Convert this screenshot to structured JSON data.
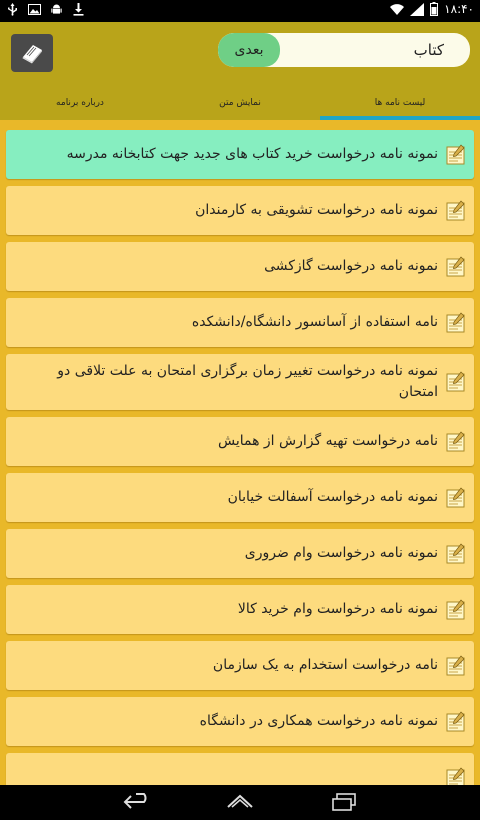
{
  "status_bar": {
    "time": "۱۸:۴۰"
  },
  "header": {
    "search": {
      "value": "کتاب"
    },
    "next_button": "بعدی",
    "book_icon": "book-icon"
  },
  "tabs": [
    {
      "label": "لیست نامه ها",
      "active": true
    },
    {
      "label": "نمایش متن",
      "active": false
    },
    {
      "label": "درباره برنامه",
      "active": false
    }
  ],
  "letters": [
    {
      "title": "نمونه نامه درخواست خرید کتاب های جدید جهت کتابخانه مدرسه",
      "selected": true
    },
    {
      "title": "نمونه نامه درخواست تشویقی به کارمندان"
    },
    {
      "title": "نمونه نامه درخواست گازکشی"
    },
    {
      "title": "نامه استفاده از آسانسور دانشگاه/دانشکده"
    },
    {
      "title": "نمونه نامه درخواست تغییر زمان برگزاری امتحان به علت تلاقی دو امتحان"
    },
    {
      "title": "نامه درخواست تهیه گزارش از همایش"
    },
    {
      "title": "نمونه نامه درخواست آسفالت خیابان"
    },
    {
      "title": "نمونه نامه درخواست وام ضروری"
    },
    {
      "title": "نمونه نامه درخواست وام خرید کالا"
    },
    {
      "title": "نامه درخواست استخدام به یک سازمان"
    },
    {
      "title": "نمونه نامه درخواست همکاری در دانشگاه"
    },
    {
      "title": ""
    }
  ],
  "colors": {
    "header_bg": "#b9a41a",
    "list_bg": "#e9b829",
    "item_bg": "#fddb7e",
    "item_selected_bg": "#86eec0",
    "tab_indicator": "#21a6c4",
    "next_button_bg": "#6fcf86"
  }
}
